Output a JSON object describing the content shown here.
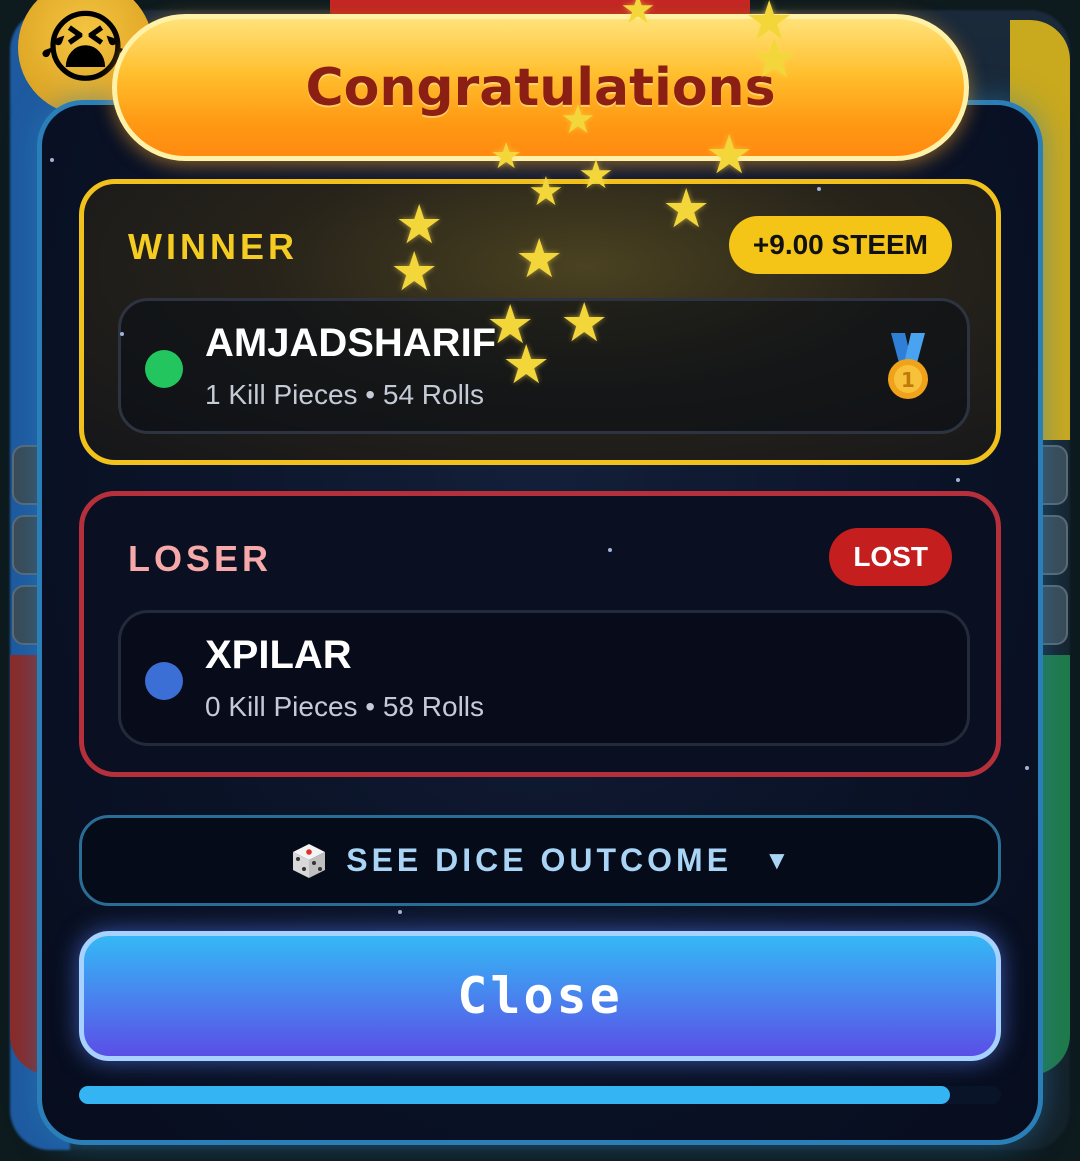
{
  "background": {
    "emoji": "😭"
  },
  "modal": {
    "title": "Congratulations",
    "winner": {
      "label": "WINNER",
      "reward": "+9.00 STEEM",
      "player": {
        "name": "AMJADSHARIF",
        "stats": "1 Kill Pieces • 54 Rolls",
        "color": "#22c55e",
        "icon": "first-place-medal-icon"
      }
    },
    "loser": {
      "label": "LOSER",
      "status": "LOST",
      "player": {
        "name": "XPILAR",
        "stats": "0 Kill Pieces • 58 Rolls",
        "color": "#3b6fd6"
      }
    },
    "dice_outcome": {
      "icon": "dice-icon",
      "label": "SEE DICE OUTCOME",
      "caret": "▼"
    },
    "close_label": "Close",
    "progress": 0.945
  },
  "colors": {
    "winner_border": "#f1c21b",
    "loser_border": "#b5303a",
    "modal_border": "#2a7fb8",
    "reward_badge": "#f4c417",
    "lost_badge": "#c41e1e"
  }
}
